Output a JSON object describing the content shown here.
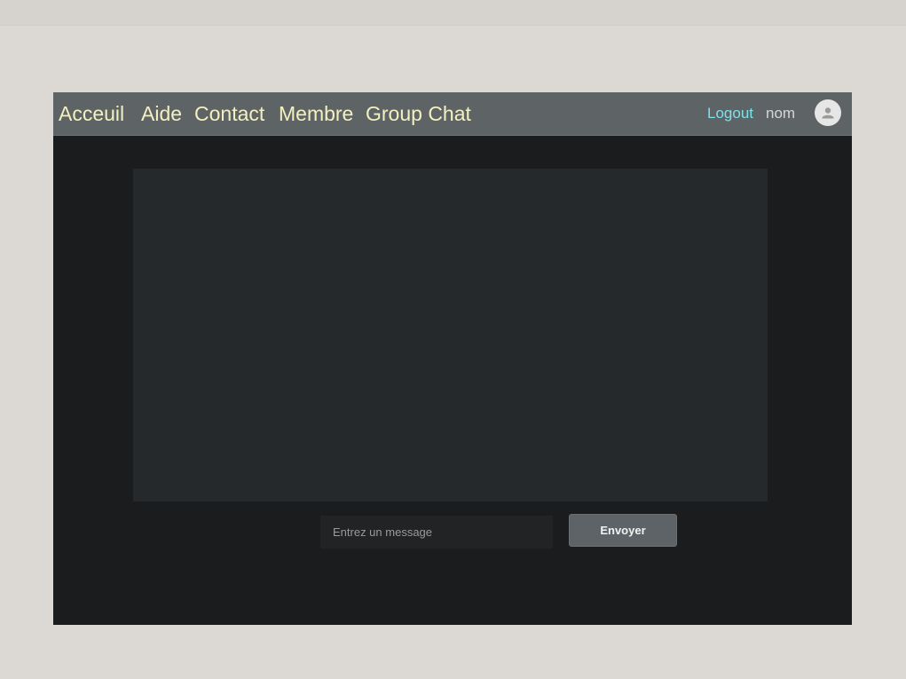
{
  "nav": {
    "links": [
      {
        "label": "Acceuil"
      },
      {
        "label": "Aide"
      },
      {
        "label": "Contact"
      },
      {
        "label": "Membre"
      },
      {
        "label": "Group Chat"
      }
    ],
    "logout_label": "Logout",
    "user_name": "nom",
    "avatar_icon": "person-icon"
  },
  "chat": {
    "input_placeholder": "Entrez un message",
    "input_value": "",
    "send_label": "Envoyer"
  },
  "colors": {
    "page_background": "#dcd9d4",
    "navbar": "#5e6466",
    "nav_link": "#f3f0c0",
    "logout_link": "#7fe0e8",
    "app_background": "#1b1c1e",
    "chat_area": "#26292c",
    "button": "#5d6366"
  }
}
